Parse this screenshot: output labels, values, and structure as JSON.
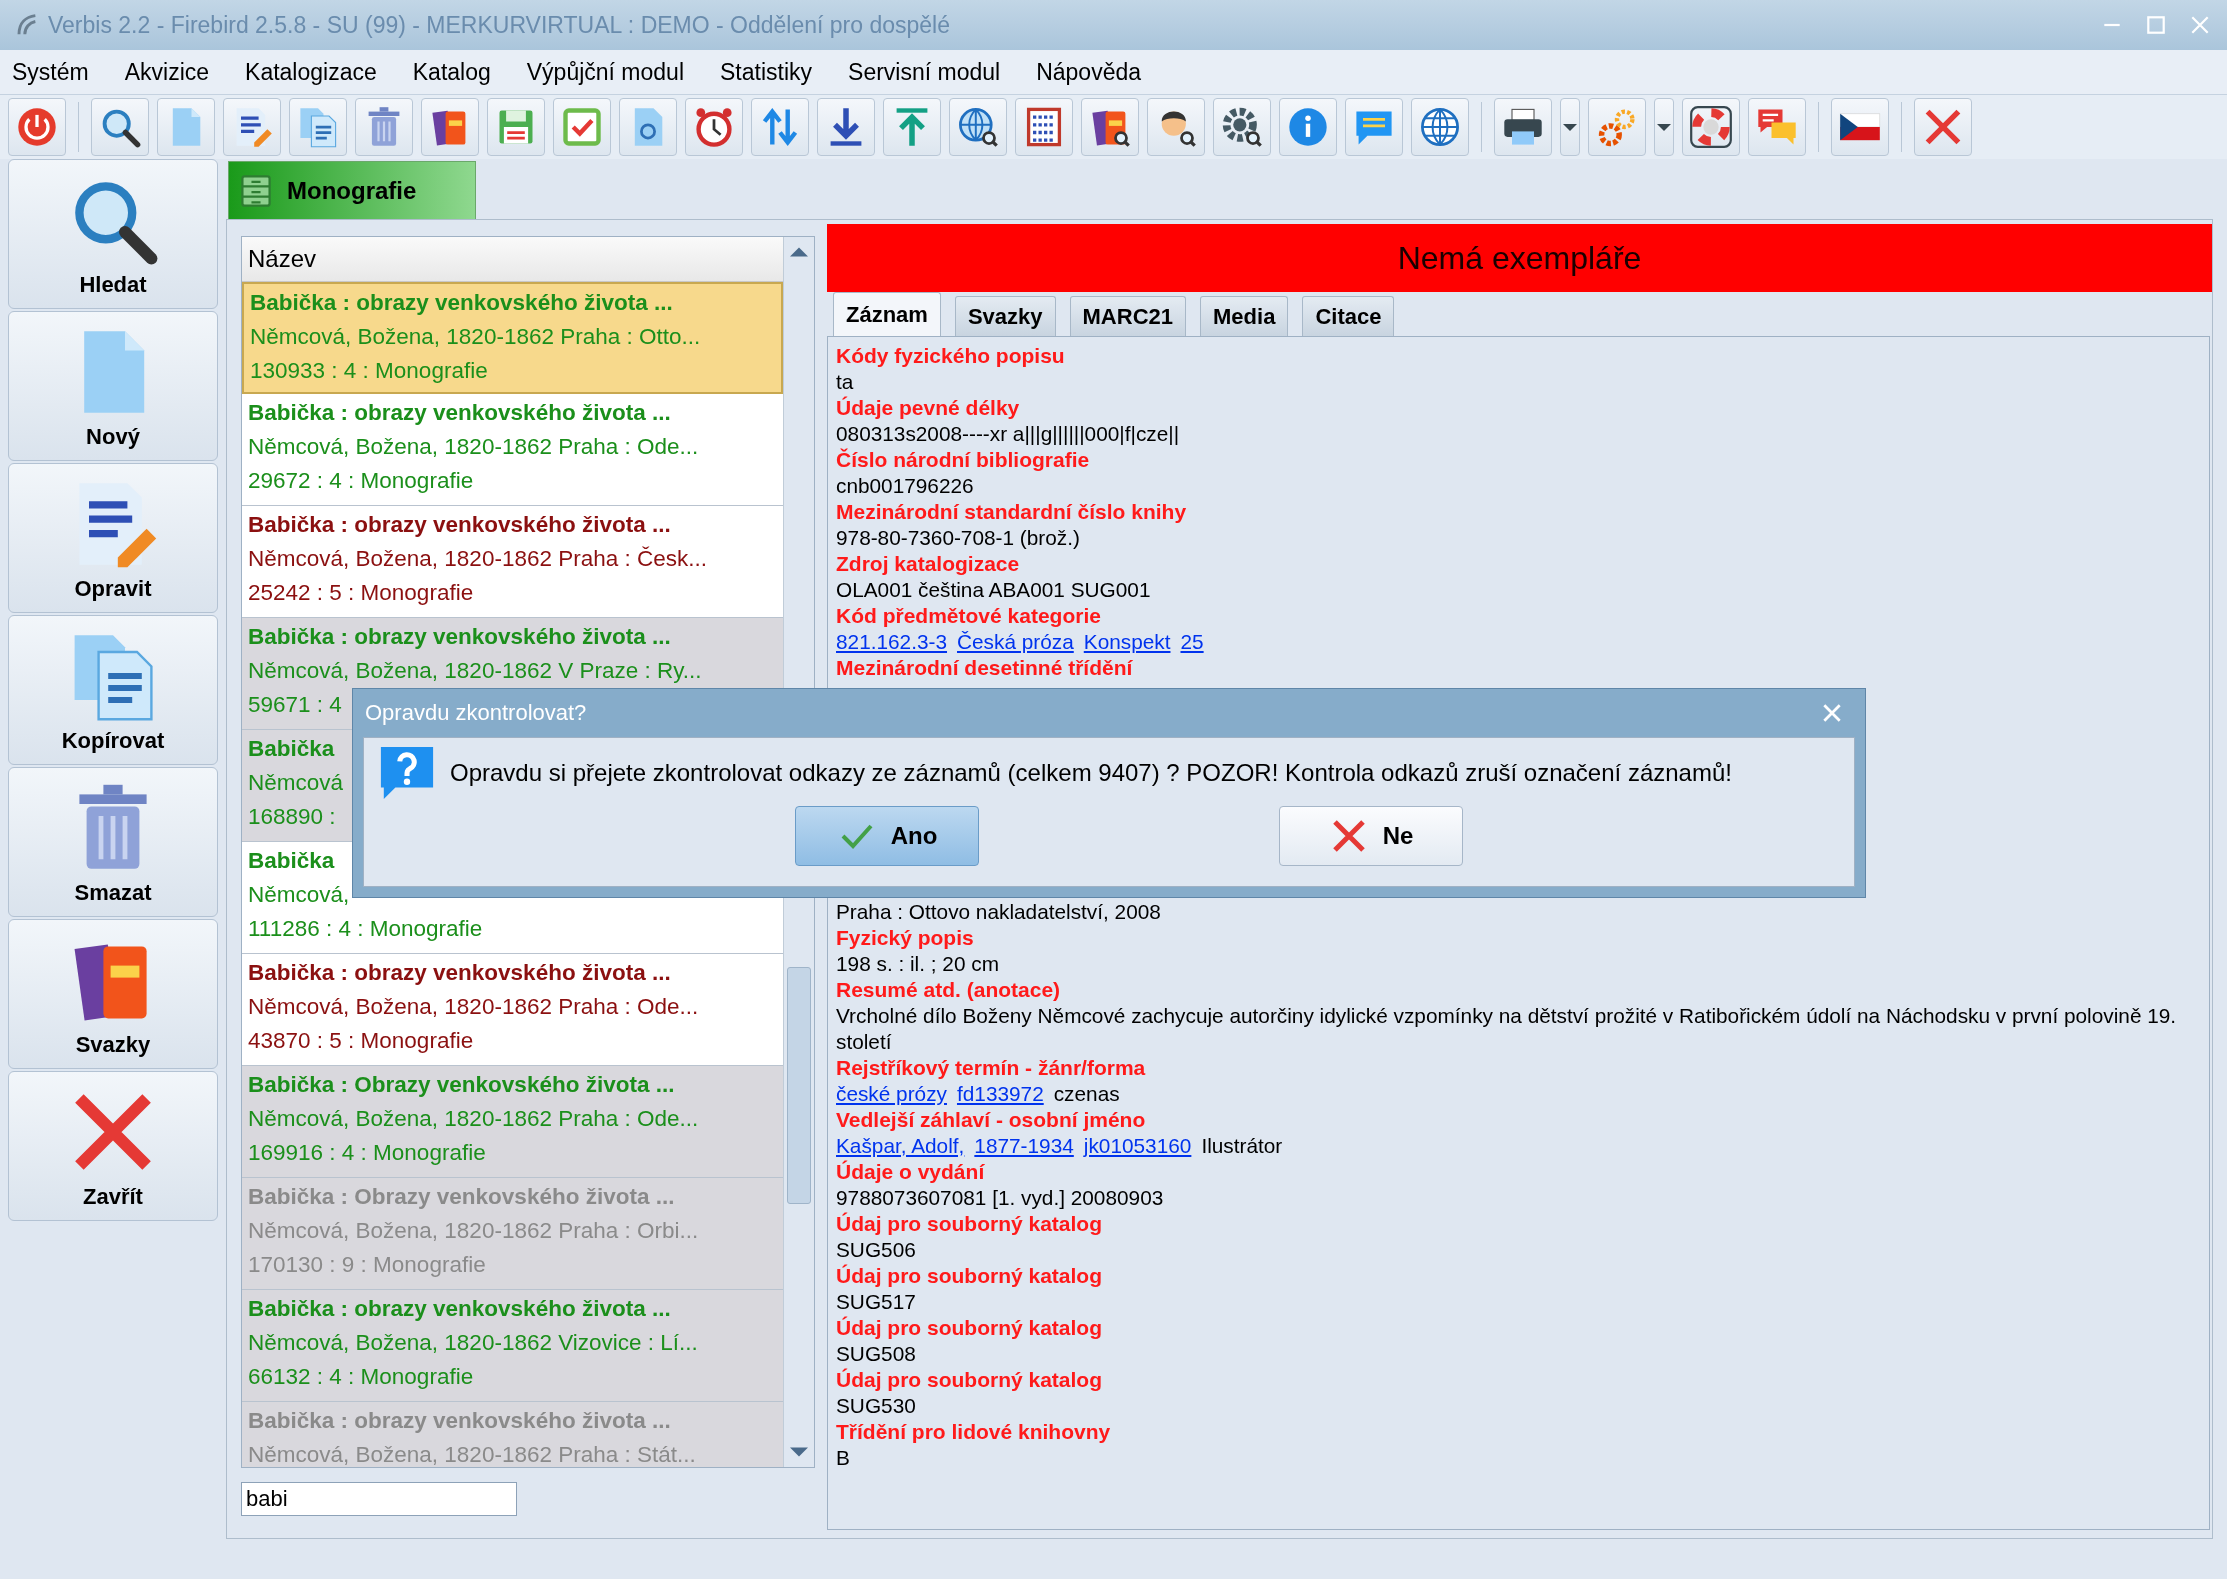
{
  "window": {
    "title": "Verbis 2.2 - Firebird 2.5.8 - SU (99) - MERKURVIRTUAL : DEMO - Oddělení pro dospělé"
  },
  "menu": [
    "Systém",
    "Akvizice",
    "Katalogizace",
    "Katalog",
    "Výpůjční modul",
    "Statistiky",
    "Servisní modul",
    "Nápověda"
  ],
  "sidebar": [
    {
      "label": "Hledat",
      "kind": "search"
    },
    {
      "label": "Nový",
      "kind": "new"
    },
    {
      "label": "Opravit",
      "kind": "edit"
    },
    {
      "label": "Kopírovat",
      "kind": "copy"
    },
    {
      "label": "Smazat",
      "kind": "delete"
    },
    {
      "label": "Svazky",
      "kind": "volumes"
    },
    {
      "label": "Zavřít",
      "kind": "close"
    }
  ],
  "document_tab": {
    "label": "Monografie",
    "selected": true
  },
  "list": {
    "header": "Název",
    "rows": [
      {
        "lines": [
          "Babička : obrazy venkovského života ...",
          "Němcová, Božena, 1820-1862 Praha : Otto...",
          "130933 : 4 : Monografie"
        ],
        "color": "#1b8f1b",
        "selected": true
      },
      {
        "lines": [
          "Babička : obrazy venkovského života ...",
          "Němcová, Božena, 1820-1862 Praha : Ode...",
          "29672 : 4 : Monografie"
        ],
        "color": "#1b8f1b",
        "selected": false,
        "shaded": false
      },
      {
        "lines": [
          "Babička : obrazy venkovského života ...",
          "Němcová, Božena, 1820-1862 Praha : Česk...",
          "25242 : 5 : Monografie"
        ],
        "color": "#8b1010",
        "selected": false,
        "shaded": false
      },
      {
        "lines": [
          "Babička : obrazy venkovského života ...",
          "Němcová, Božena, 1820-1862 V Praze : Ry...",
          "59671 : 4"
        ],
        "color": "#1b8f1b",
        "selected": false,
        "shaded": true
      },
      {
        "lines": [
          "Babička",
          "Němcová",
          "168890 :"
        ],
        "color": "#1b8f1b",
        "selected": false,
        "shaded": true
      },
      {
        "lines": [
          "Babička",
          "Němcová,",
          "111286 : 4 : Monografie"
        ],
        "color": "#1b8f1b",
        "selected": false,
        "shaded": false
      },
      {
        "lines": [
          "Babička : obrazy venkovského života ...",
          "Němcová, Božena, 1820-1862 Praha : Ode...",
          "43870 : 5 : Monografie"
        ],
        "color": "#8b1010",
        "selected": false,
        "shaded": false
      },
      {
        "lines": [
          "Babička : Obrazy venkovského života ...",
          "Němcová, Božena, 1820-1862 Praha : Ode...",
          "169916 : 4 : Monografie"
        ],
        "color": "#1b8f1b",
        "selected": false,
        "shaded": true
      },
      {
        "lines": [
          "Babička : Obrazy venkovského života ...",
          "Němcová, Božena, 1820-1862 Praha : Orbi...",
          "170130 : 9 : Monografie"
        ],
        "color": "#8a8a8a",
        "selected": false,
        "shaded": true
      },
      {
        "lines": [
          "Babička : obrazy venkovského života ...",
          "Němcová, Božena, 1820-1862 Vizovice : Lí...",
          "66132 : 4 : Monografie"
        ],
        "color": "#1b8f1b",
        "selected": false,
        "shaded": true
      },
      {
        "lines": [
          "Babička : obrazy venkovského života ...",
          "Němcová, Božena, 1820-1862 Praha : Stát..."
        ],
        "color": "#8a8a8a",
        "selected": false,
        "shaded": true
      }
    ],
    "search": {
      "value": "babi"
    }
  },
  "detail": {
    "banner": "Nemá exempláře",
    "tabs": [
      {
        "label": "Záznam",
        "selected": true
      },
      {
        "label": "Svazky",
        "selected": false
      },
      {
        "label": "MARC21",
        "selected": false
      },
      {
        "label": "Media",
        "selected": false
      },
      {
        "label": "Citace",
        "selected": false
      }
    ],
    "fields_upper": [
      {
        "heading": "Kódy fyzického popisu",
        "value": [
          {
            "text": "ta",
            "link": false
          }
        ]
      },
      {
        "heading": "Údaje pevné délky",
        "value": [
          {
            "text": "080313s2008----xr a|||g||||||000|f|cze||",
            "link": false
          }
        ]
      },
      {
        "heading": "Číslo národní bibliografie",
        "value": [
          {
            "text": "cnb001796226",
            "link": false
          }
        ]
      },
      {
        "heading": "Mezinárodní standardní číslo knihy",
        "value": [
          {
            "text": "978-80-7360-708-1  (brož.)",
            "link": false
          }
        ]
      },
      {
        "heading": "Zdroj katalogizace",
        "value": [
          {
            "text": "OLA001  čeština ABA001  SUG001",
            "link": false
          }
        ]
      },
      {
        "heading": "Kód předmětové kategorie",
        "value": [
          {
            "text": "821.162.3-3",
            "link": true
          },
          {
            "text": "Česká próza",
            "link": true
          },
          {
            "text": "Konspekt",
            "link": true
          },
          {
            "text": "25",
            "link": true
          }
        ]
      },
      {
        "heading": "Mezinárodní desetinné třídění"
      }
    ],
    "fields_lower": [
      {
        "value": [
          {
            "text": "Praha :  Ottovo nakladatelství,  2008",
            "link": false
          }
        ]
      },
      {
        "heading": "Fyzický popis",
        "value": [
          {
            "text": "198 s. :  il. ;  20 cm",
            "link": false
          }
        ]
      },
      {
        "heading": "Resumé atd. (anotace)",
        "value": [
          {
            "text": "Vrcholné dílo Boženy Němcové zachycuje autorčiny idylické vzpomínky na dětství prožité v Ratibořickém údolí na Náchodsku v první polovině 19. století",
            "link": false
          }
        ]
      },
      {
        "heading": "Rejstříkový termín - žánr/forma",
        "value": [
          {
            "text": "české prózy",
            "link": true
          },
          {
            "text": "fd133972",
            "link": true
          },
          {
            "text": "czenas",
            "link": false
          }
        ]
      },
      {
        "heading": "Vedlejší záhlaví - osobní jméno",
        "value": [
          {
            "text": "Kašpar, Adolf,",
            "link": true
          },
          {
            "text": "1877-1934",
            "link": true
          },
          {
            "text": "jk01053160",
            "link": true
          },
          {
            "text": "Ilustrátor",
            "link": false
          }
        ]
      },
      {
        "heading": "Údaje o vydání",
        "value": [
          {
            "text": "9788073607081  [1. vyd.]  20080903",
            "link": false
          }
        ]
      },
      {
        "heading": "Údaj pro souborný katalog",
        "value": [
          {
            "text": "SUG506",
            "link": false
          }
        ]
      },
      {
        "heading": "Údaj pro souborný katalog",
        "value": [
          {
            "text": "SUG517",
            "link": false
          }
        ]
      },
      {
        "heading": "Údaj pro souborný katalog",
        "value": [
          {
            "text": "SUG508",
            "link": false
          }
        ]
      },
      {
        "heading": "Údaj pro souborný katalog",
        "value": [
          {
            "text": "SUG530",
            "link": false
          }
        ]
      },
      {
        "heading": "Třídění pro lidové knihovny",
        "value": [
          {
            "text": "B",
            "link": false
          }
        ]
      }
    ]
  },
  "dialog": {
    "title": "Opravdu zkontrolovat?",
    "message": "Opravdu si přejete zkontrolovat odkazy ze záznamů (celkem 9407) ? POZOR! Kontrola odkazů zruší označení záznamů!",
    "buttons": [
      {
        "label": "Ano",
        "kind": "yes",
        "selected": true
      },
      {
        "label": "Ne",
        "kind": "no",
        "selected": false
      }
    ]
  }
}
